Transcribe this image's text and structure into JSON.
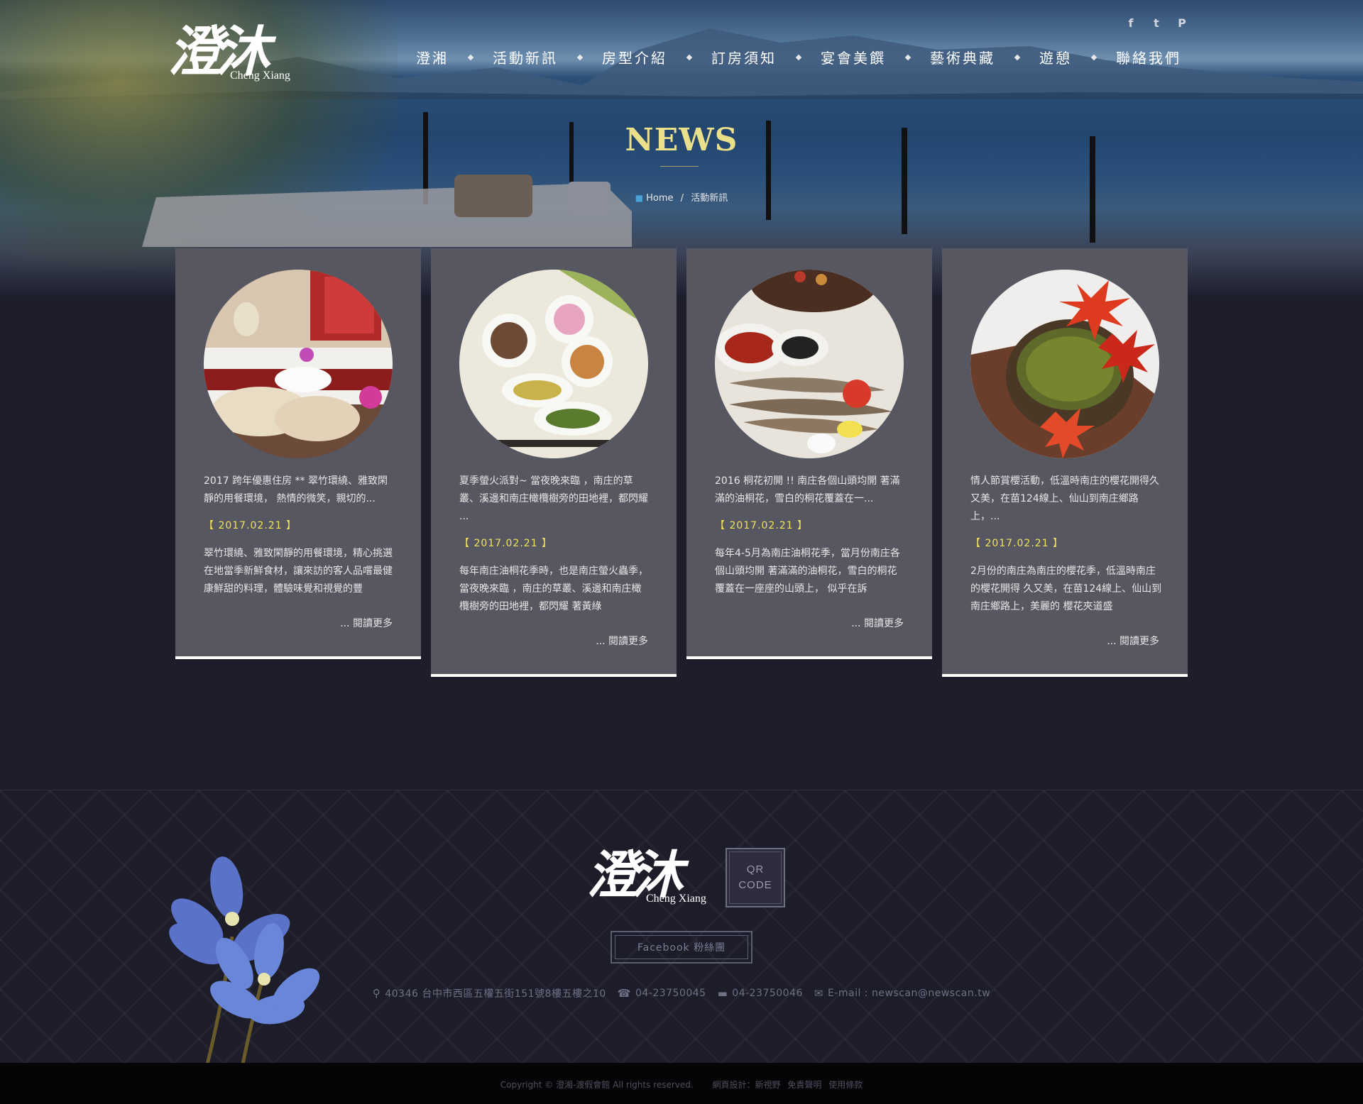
{
  "brand": {
    "logo_chars": "澄沐",
    "logo_sub": "Cheng Xiang"
  },
  "social": {
    "facebook": "f",
    "twitter": "t",
    "flag": "P"
  },
  "nav": {
    "items": [
      "澄湘",
      "活動新訊",
      "房型介紹",
      "訂房須知",
      "宴會美饌",
      "藝術典藏",
      "遊憩",
      "聯絡我們"
    ]
  },
  "hero": {
    "title": "NEWS",
    "crumb_home": "Home",
    "crumb_sep": "/",
    "crumb_current": "活動新訊"
  },
  "cards": [
    {
      "excerpt": "2017 跨年優惠住房 ** 翠竹環繞、雅致閑靜的用餐環境， 熱情的微笑，親切的...",
      "date": "【 2017.02.21 】",
      "body": "翠竹環繞、雅致閑靜的用餐環境，精心挑選在地當季新鮮食材，讓來訪的客人品嚐最健康鮮甜的料理，體驗味覺和視覺的豐",
      "more": "... 閱讀更多",
      "image": "towel-icon"
    },
    {
      "excerpt": "夏季螢火派對~ 當夜晚來臨 ，南庄的草叢、溪邊和南庄橄欖樹旁的田地裡，都閃耀 ...",
      "date": "【 2017.02.21 】",
      "body": "每年南庄油桐花季時，也是南庄螢火蟲季，當夜晚來臨 ，南庄的草叢、溪邊和南庄橄欖樹旁的田地裡，都閃耀 著黃綠",
      "more": "... 閱讀更多",
      "image": "dishes-icon"
    },
    {
      "excerpt": "2016 桐花初開 !! 南庄各個山頭均開 著滿滿的油桐花，雪白的桐花覆蓋在一...",
      "date": "【 2017.02.21 】",
      "body": "每年4-5月為南庄油桐花季，當月份南庄各個山頭均開 著滿滿的油桐花，雪白的桐花覆蓋在一座座的山頭上， 似乎在訴",
      "more": "... 閱讀更多",
      "image": "fish-icon"
    },
    {
      "excerpt": "情人節賞櫻活動，低溫時南庄的櫻花開得久又美，在苗124線上、仙山到南庄鄉路上，...",
      "date": "【 2017.02.21 】",
      "body": "2月份的南庄為南庄的櫻花季，低溫時南庄的櫻花開得 久又美，在苗124線上、仙山到南庄鄉路上，美麗的 櫻花夾道盛",
      "more": "... 閱讀更多",
      "image": "tea-icon"
    }
  ],
  "footer": {
    "logo_chars": "澄沐",
    "logo_sub": "Cheng Xiang",
    "qr_line1": "QR",
    "qr_line2": "CODE",
    "facebook": "Facebook 粉絲團",
    "address": "40346 台中市西區五權五街151號8樓五樓之10",
    "phone": "04-23750045",
    "fax": "04-23750046",
    "email": "E-mail : newscan@newscan.tw",
    "copyright": "Copyright © 澄湘-渡假會館 All rights reserved.",
    "design": "網頁設計：新視野",
    "disclaimer": "免責聲明",
    "terms": "使用條款"
  }
}
